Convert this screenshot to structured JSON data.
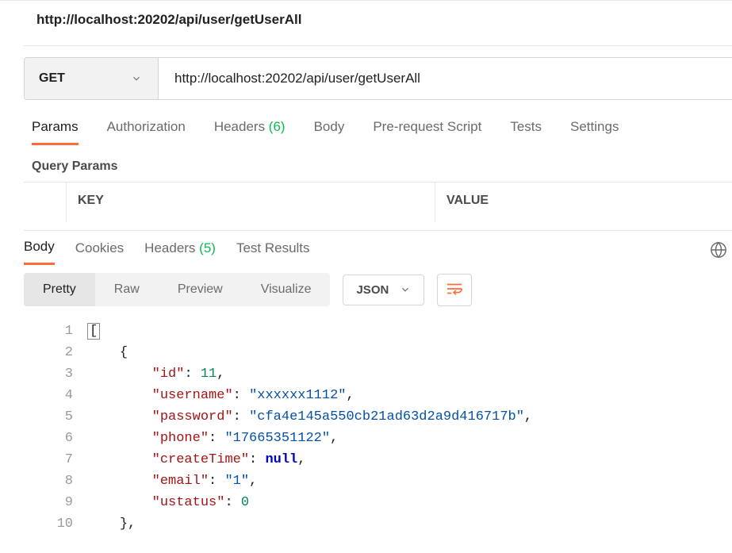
{
  "header": {
    "title": "http://localhost:20202/api/user/getUserAll"
  },
  "request": {
    "method": "GET",
    "url": "http://localhost:20202/api/user/getUserAll"
  },
  "requestTabs": {
    "items": [
      {
        "label": "Params",
        "active": true
      },
      {
        "label": "Authorization"
      },
      {
        "label": "Headers",
        "count": "(6)"
      },
      {
        "label": "Body"
      },
      {
        "label": "Pre-request Script"
      },
      {
        "label": "Tests"
      },
      {
        "label": "Settings"
      }
    ]
  },
  "paramsSection": {
    "subheader": "Query Params",
    "columns": {
      "key": "KEY",
      "value": "VALUE"
    }
  },
  "responseTabs": {
    "items": [
      {
        "label": "Body",
        "active": true
      },
      {
        "label": "Cookies"
      },
      {
        "label": "Headers",
        "count": "(5)"
      },
      {
        "label": "Test Results"
      }
    ]
  },
  "viewTabs": {
    "items": [
      {
        "label": "Pretty",
        "active": true
      },
      {
        "label": "Raw"
      },
      {
        "label": "Preview"
      },
      {
        "label": "Visualize"
      }
    ]
  },
  "formatSelect": "JSON",
  "responseBody": [
    {
      "indent": 0,
      "tokens": [
        {
          "t": "p",
          "v": "[",
          "hl": true
        }
      ]
    },
    {
      "indent": 1,
      "tokens": [
        {
          "t": "p",
          "v": "{"
        }
      ]
    },
    {
      "indent": 2,
      "tokens": [
        {
          "t": "k",
          "v": "\"id\""
        },
        {
          "t": "p",
          "v": ": "
        },
        {
          "t": "n",
          "v": "11"
        },
        {
          "t": "p",
          "v": ","
        }
      ]
    },
    {
      "indent": 2,
      "tokens": [
        {
          "t": "k",
          "v": "\"username\""
        },
        {
          "t": "p",
          "v": ": "
        },
        {
          "t": "s",
          "v": "\"xxxxxx1112\""
        },
        {
          "t": "p",
          "v": ","
        }
      ]
    },
    {
      "indent": 2,
      "tokens": [
        {
          "t": "k",
          "v": "\"password\""
        },
        {
          "t": "p",
          "v": ": "
        },
        {
          "t": "s",
          "v": "\"cfa4e145a550cb21ad63d2a9d416717b\""
        },
        {
          "t": "p",
          "v": ","
        }
      ]
    },
    {
      "indent": 2,
      "tokens": [
        {
          "t": "k",
          "v": "\"phone\""
        },
        {
          "t": "p",
          "v": ": "
        },
        {
          "t": "s",
          "v": "\"17665351122\""
        },
        {
          "t": "p",
          "v": ","
        }
      ]
    },
    {
      "indent": 2,
      "tokens": [
        {
          "t": "k",
          "v": "\"createTime\""
        },
        {
          "t": "p",
          "v": ": "
        },
        {
          "t": "kw",
          "v": "null"
        },
        {
          "t": "p",
          "v": ","
        }
      ]
    },
    {
      "indent": 2,
      "tokens": [
        {
          "t": "k",
          "v": "\"email\""
        },
        {
          "t": "p",
          "v": ": "
        },
        {
          "t": "s",
          "v": "\"1\""
        },
        {
          "t": "p",
          "v": ","
        }
      ]
    },
    {
      "indent": 2,
      "tokens": [
        {
          "t": "k",
          "v": "\"ustatus\""
        },
        {
          "t": "p",
          "v": ": "
        },
        {
          "t": "n",
          "v": "0"
        }
      ]
    },
    {
      "indent": 1,
      "tokens": [
        {
          "t": "p",
          "v": "},"
        }
      ]
    }
  ]
}
